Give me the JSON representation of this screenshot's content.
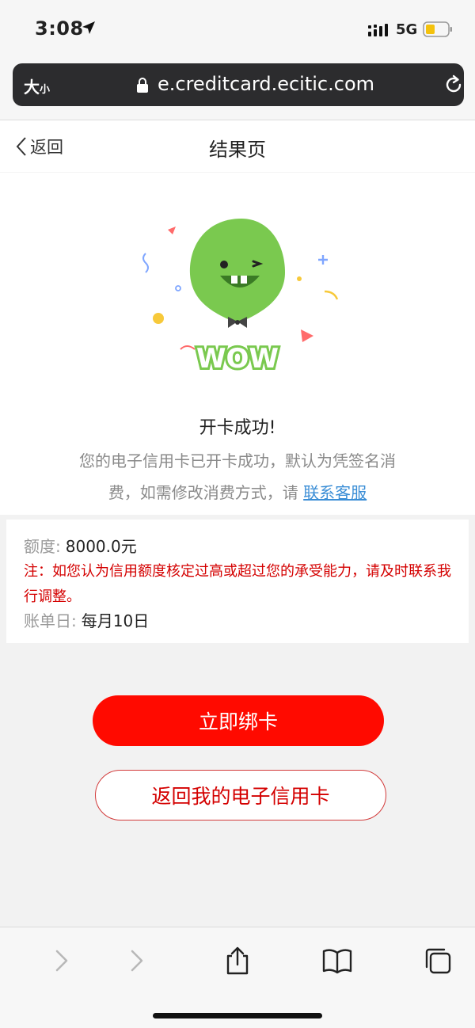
{
  "status_bar": {
    "time": "3:08",
    "network": "5G",
    "icons": [
      "location-arrow-icon",
      "signal-icon",
      "battery-icon"
    ]
  },
  "browser": {
    "text_size_label_big": "大",
    "text_size_label_small": "小",
    "url": "e.creditcard.ecitic.com"
  },
  "nav": {
    "back_label": "返回",
    "title": "结果页"
  },
  "result": {
    "title": "开卡成功!",
    "description": "您的电子信用卡已开卡成功，默认为凭签名消费，如需修改消费方式，请 ",
    "link_label": "联系客服",
    "illustration_text": "WOW"
  },
  "info": {
    "limit_label": "额度:",
    "limit_value": "8000.0元",
    "note": "注：如您认为信用额度核定过高或超过您的承受能力，请及时联系我行调整。",
    "bill_day_label": "账单日:",
    "bill_day_value": "每月10日"
  },
  "actions": {
    "bind_card": "立即绑卡",
    "back_to_card": "返回我的电子信用卡"
  },
  "colors": {
    "accent_red": "#ff0a00",
    "note_red": "#d40000",
    "link_blue": "#3b8ed6",
    "balloon_green": "#7ac94f"
  }
}
